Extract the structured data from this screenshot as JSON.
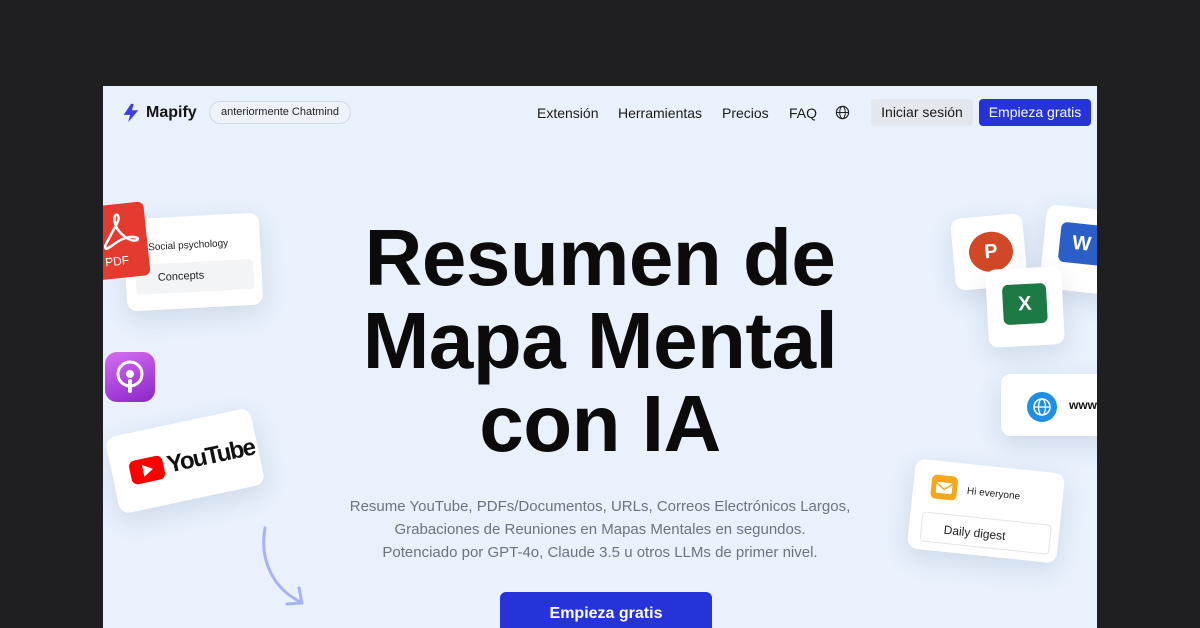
{
  "header": {
    "brand": "Mapify",
    "formerly": "anteriormente Chatmind",
    "nav": [
      {
        "label": "Extensión"
      },
      {
        "label": "Herramientas"
      },
      {
        "label": "Precios"
      },
      {
        "label": "FAQ"
      }
    ],
    "login": "Iniciar sesión",
    "start": "Empieza gratis"
  },
  "hero": {
    "title_lines": [
      "Resumen de",
      "Mapa Mental",
      "con IA"
    ],
    "subtitle_lines": [
      "Resume YouTube, PDFs/Documentos, URLs, Correos Electrónicos Largos,",
      "Grabaciones de Reuniones en Mapas Mentales en segundos.",
      "Potenciado por GPT-4o, Claude 3.5 u otros LLMs de primer nivel."
    ],
    "cta": "Empieza gratis"
  },
  "cards": {
    "doc": {
      "line1": "Social psychology",
      "line2": "Concepts"
    },
    "pdf": "PDF",
    "youtube": "YouTube",
    "ppt": "P",
    "word": "W",
    "excel": "X",
    "web": "www",
    "mail": {
      "greeting": "Hi everyone",
      "subject": "Daily digest"
    }
  },
  "colors": {
    "accent": "#2633d8",
    "background": "#e8f1fc",
    "pdf": "#e53b2f",
    "youtube": "#ff0000",
    "ppt": "#d24726",
    "word": "#2b5fc7",
    "excel": "#1d7a45"
  },
  "icons": {
    "logo": "lightning-bolt-icon",
    "language": "globe-icon"
  }
}
